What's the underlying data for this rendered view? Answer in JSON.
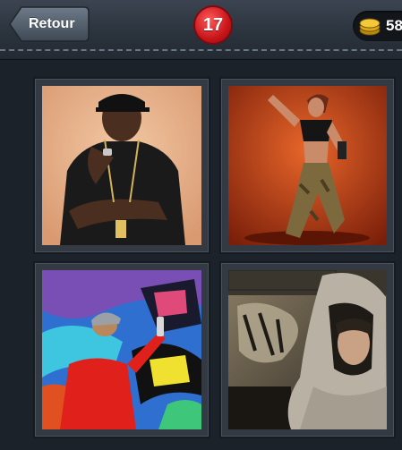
{
  "header": {
    "back_label": "Retour",
    "level": "17",
    "coins": "58"
  },
  "tiles": [
    {
      "icon": "rapper-photo"
    },
    {
      "icon": "hiphop-dancer-photo"
    },
    {
      "icon": "graffiti-artist-photo"
    },
    {
      "icon": "hooded-figure-photo"
    }
  ],
  "colors": {
    "badge": "#c8151a",
    "topbar": "#2a323c",
    "background": "#1c2229"
  }
}
